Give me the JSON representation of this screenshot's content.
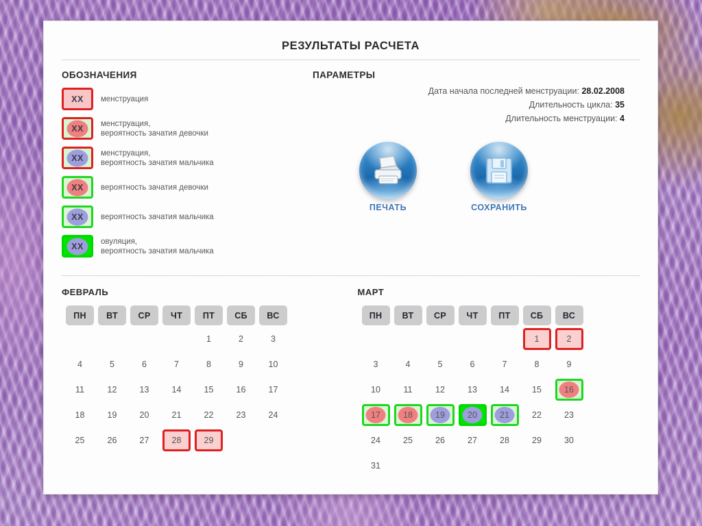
{
  "page": {
    "title": "РЕЗУЛЬТАТЫ РАСЧЕТА"
  },
  "legend": {
    "heading": "ОБОЗНАЧЕНИЯ",
    "swatch_text": "XX",
    "items": [
      {
        "style": "mens",
        "line1": "менструация",
        "line2": ""
      },
      {
        "style": "mgirl",
        "line1": "менструация,",
        "line2": "вероятность зачатия девочки"
      },
      {
        "style": "mboy",
        "line1": "менструация,",
        "line2": "вероятность зачатия мальчика"
      },
      {
        "style": "girl",
        "line1": "вероятность зачатия девочки",
        "line2": ""
      },
      {
        "style": "boy",
        "line1": "вероятность зачатия мальчика",
        "line2": ""
      },
      {
        "style": "ovul",
        "line1": "овуляция,",
        "line2": "вероятность зачатия мальчика"
      }
    ]
  },
  "parameters": {
    "heading": "ПАРАМЕТРЫ",
    "rows": [
      {
        "label": "Дата начала последней менструации:",
        "value": "28.02.2008"
      },
      {
        "label": "Длительность цикла:",
        "value": "35"
      },
      {
        "label": "Длительность менструации:",
        "value": "4"
      }
    ]
  },
  "actions": {
    "print": {
      "label": "ПЕЧАТЬ",
      "icon": "printer-icon"
    },
    "save": {
      "label": "СОХРАНИТЬ",
      "icon": "floppy-disk-icon"
    }
  },
  "weekdays": [
    "ПН",
    "ВТ",
    "СР",
    "ЧТ",
    "ПТ",
    "СБ",
    "ВС"
  ],
  "calendars": [
    {
      "name": "ФЕВРАЛЬ",
      "lead_blanks": 4,
      "days": 29,
      "marks": {
        "28": "mens",
        "29": "mens"
      }
    },
    {
      "name": "МАРТ",
      "lead_blanks": 5,
      "days": 31,
      "marks": {
        "1": "mens",
        "2": "mens",
        "16": "girl",
        "17": "girl",
        "18": "girl",
        "19": "boy",
        "20": "ovul",
        "21": "boy"
      }
    }
  ],
  "colors": {
    "menstruation_border": "#de2020",
    "menstruation_fill": "#fbd0d0",
    "fertile_border": "#1fd61f",
    "fertile_fill": "#d9f7d5",
    "ovulation_fill": "#00e400",
    "girl_blob": "#f08080",
    "boy_blob": "#9e9ede",
    "weekday_header": "#cccccc",
    "action_label": "#3f76b5"
  }
}
